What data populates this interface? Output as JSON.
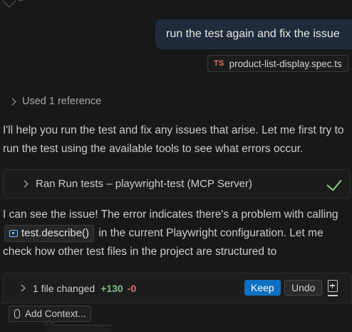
{
  "user_message": "run the test again and fix the issue",
  "reference_chip": {
    "icon": "TS",
    "filename": "product-list-display.spec.ts"
  },
  "used_references": "Used 1 reference",
  "response_intro": "I'll help you run the test and fix any issues that arise. Let me first try to run the test using the available tools to see what errors occur.",
  "tool_call": {
    "label": "Ran Run tests – playwright-test (MCP Server)",
    "status": "success"
  },
  "response_followup": {
    "before": "I can see the issue! The error indicates there's a problem with calling",
    "code": "test.describe()",
    "after": "in the current Playwright configuration. Let me check how other test files in the project are structured to"
  },
  "changes_bar": {
    "summary": "1 file changed",
    "added": "+130",
    "removed": "-0",
    "keep_label": "Keep",
    "undo_label": "Undo"
  },
  "input": {
    "add_context_label": "Add Context..."
  },
  "colors": {
    "accent": "#0e70c0",
    "added": "#81b88b",
    "removed": "#e06c75",
    "success": "#89d185",
    "ts": "#e3705e"
  }
}
